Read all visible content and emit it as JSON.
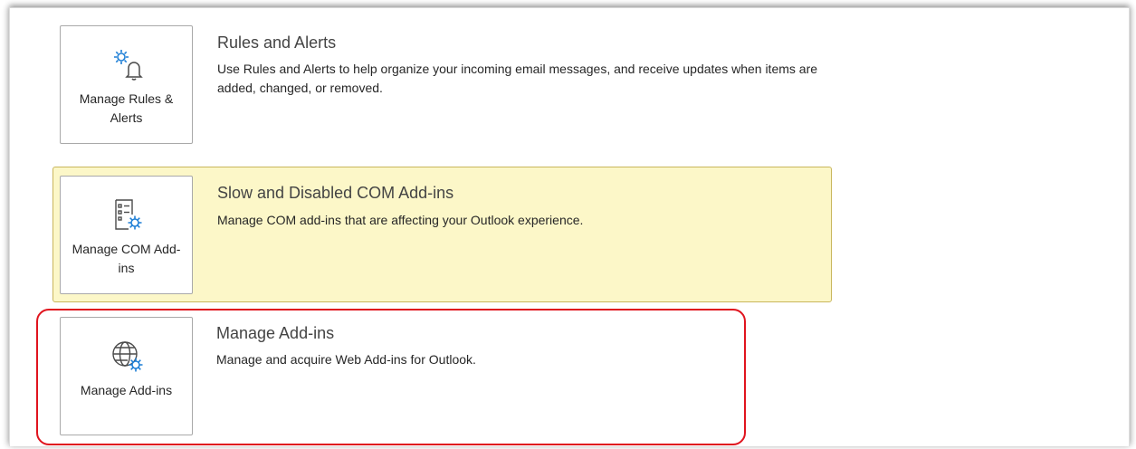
{
  "sections": [
    {
      "tile_label": "Manage Rules & Alerts",
      "tile_icon": "gear-bell-icon",
      "title": "Rules and Alerts",
      "description": "Use Rules and Alerts to help organize your incoming email messages, and receive updates when items are added, changed, or removed."
    },
    {
      "tile_label": "Manage COM Add-ins",
      "tile_icon": "list-gear-icon",
      "title": "Slow and Disabled COM Add-ins",
      "description": "Manage COM add-ins that are affecting your Outlook experience.",
      "highlighted": true
    },
    {
      "tile_label": "Manage Add-ins",
      "tile_icon": "globe-gear-icon",
      "title": "Manage Add-ins",
      "description": "Manage and acquire Web Add-ins for Outlook.",
      "annotated": true
    }
  ],
  "colors": {
    "highlight_bg": "#fcf7c8",
    "highlight_border": "#c9b65c",
    "annotation_red": "#e0141e",
    "icon_blue": "#1e7fd6",
    "icon_gray": "#4a4a4a"
  }
}
